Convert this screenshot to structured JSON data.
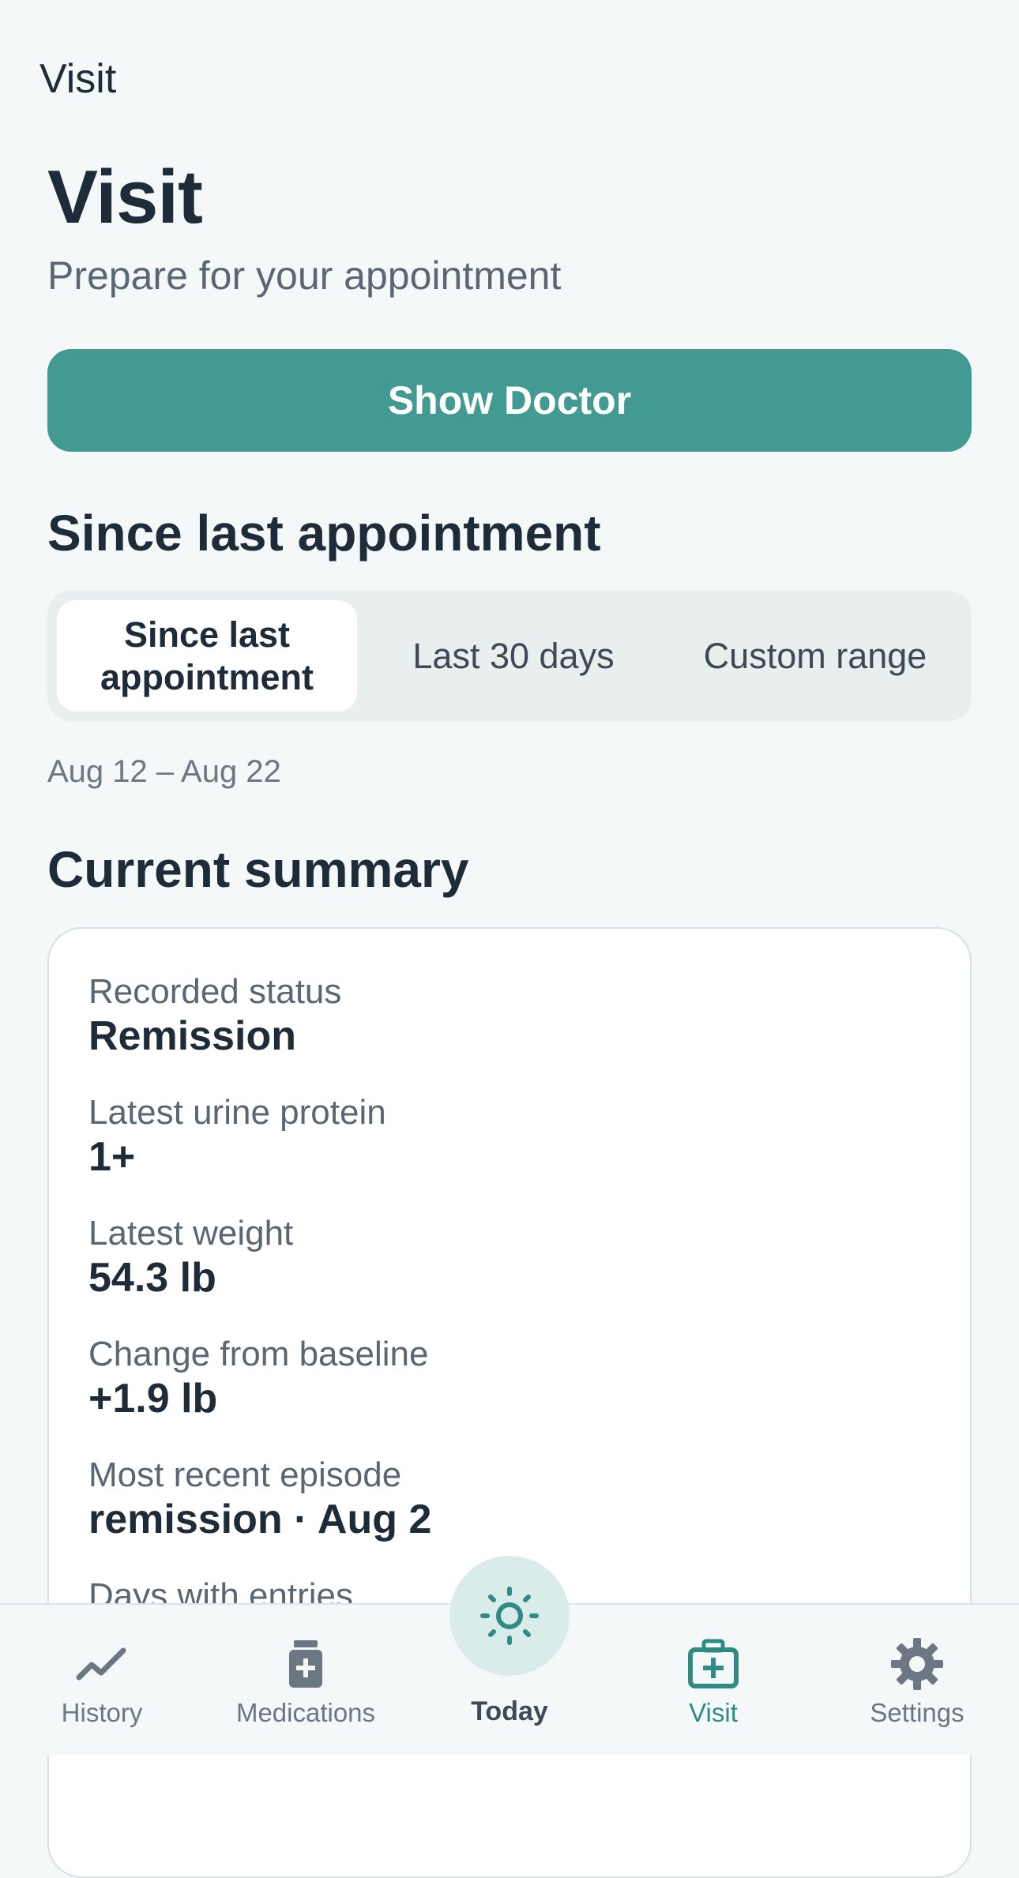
{
  "nav": {
    "title": "Visit"
  },
  "header": {
    "title": "Visit",
    "subtitle": "Prepare for your appointment"
  },
  "actions": {
    "show_doctor": "Show Doctor"
  },
  "range_section": {
    "heading": "Since last appointment",
    "options": [
      "Since last appointment",
      "Last 30 days",
      "Custom range"
    ],
    "selected": "Since last appointment",
    "date_range": "Aug 12 – Aug 22"
  },
  "summary": {
    "heading": "Current summary",
    "rows": [
      {
        "label": "Recorded status",
        "value": "Remission"
      },
      {
        "label": "Latest urine protein",
        "value": "1+"
      },
      {
        "label": "Latest weight",
        "value": "54.3 lb"
      },
      {
        "label": "Change from baseline",
        "value": "+1.9 lb"
      },
      {
        "label": "Most recent episode",
        "value": "remission · Aug 2"
      },
      {
        "label": "Days with entries",
        "value": ""
      }
    ]
  },
  "tabbar": {
    "items": [
      {
        "label": "History",
        "icon": "chart-line-icon"
      },
      {
        "label": "Medications",
        "icon": "medicine-bottle-icon"
      },
      {
        "label": "Today",
        "icon": "sun-icon"
      },
      {
        "label": "Visit",
        "icon": "medical-bag-icon",
        "active": true
      },
      {
        "label": "Settings",
        "icon": "gear-icon"
      }
    ]
  },
  "colors": {
    "accent": "#429a92",
    "active_tab": "#2f8b83",
    "background": "#f4f8f8"
  }
}
